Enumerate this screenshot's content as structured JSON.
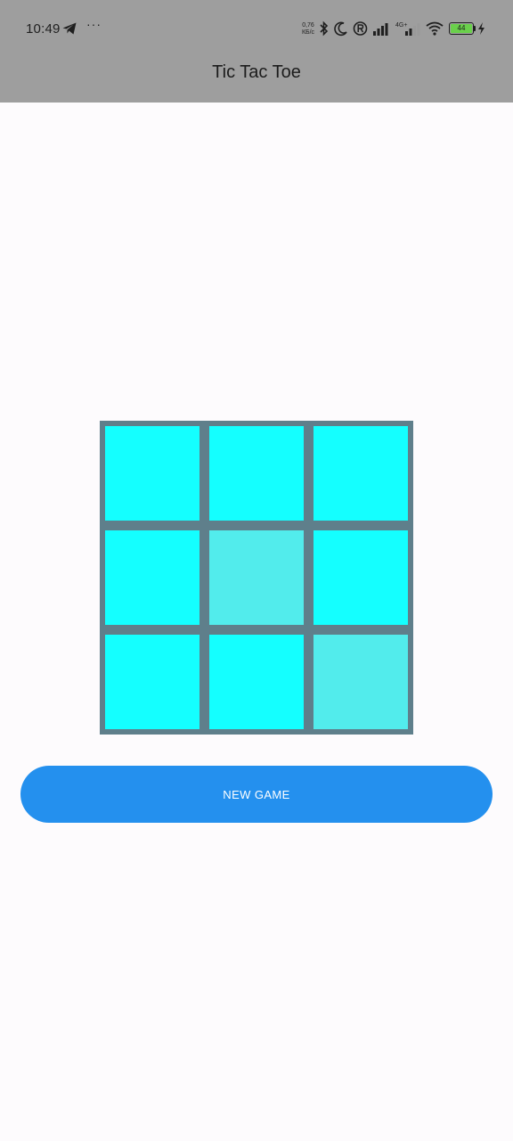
{
  "status_bar": {
    "time": "10:49",
    "more": "···",
    "net_speed_value": "0,76",
    "net_speed_unit": "КБ/с",
    "network_label": "4G+",
    "battery_level": "44"
  },
  "app_bar": {
    "title": "Tic Tac Toe"
  },
  "board": {
    "cells": [
      {
        "color": "#14ffff"
      },
      {
        "color": "#14ffff"
      },
      {
        "color": "#14ffff"
      },
      {
        "color": "#14ffff"
      },
      {
        "color": "#52ecec"
      },
      {
        "color": "#14ffff"
      },
      {
        "color": "#14ffff"
      },
      {
        "color": "#14ffff"
      },
      {
        "color": "#52ecec"
      }
    ]
  },
  "actions": {
    "new_game_label": "NEW GAME"
  },
  "colors": {
    "app_bar": "#9e9e9e",
    "background": "#fdfbfd",
    "board_grid": "#5f7f8b",
    "cell_default": "#14ffff",
    "cell_highlight": "#52ecec",
    "button": "#2490ee"
  }
}
